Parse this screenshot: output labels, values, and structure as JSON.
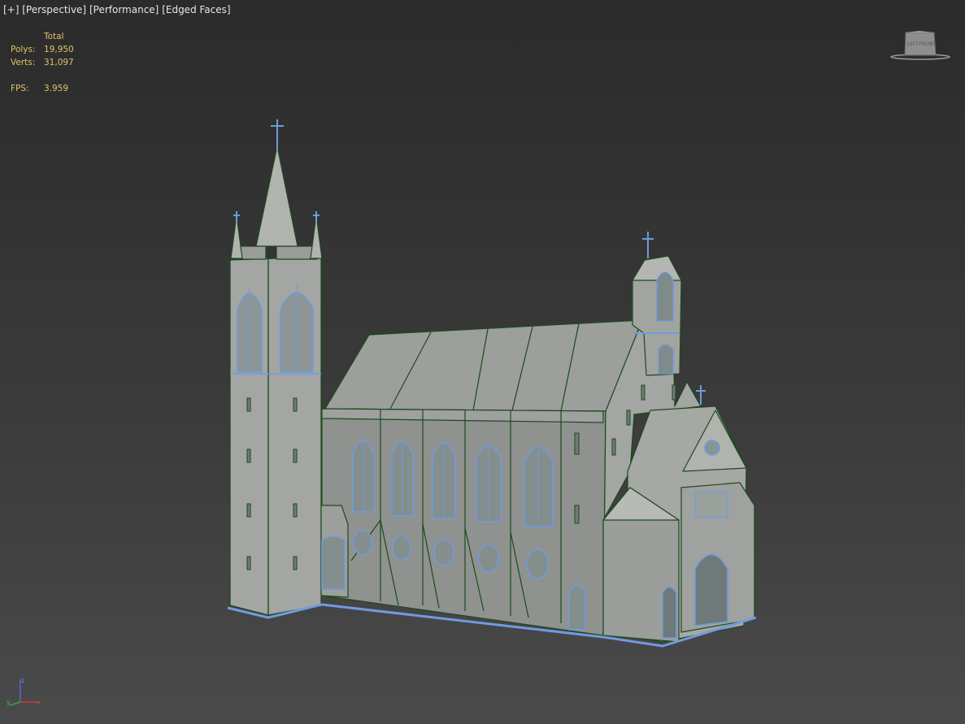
{
  "viewport": {
    "menu_plus": "[+]",
    "menu_view": "[Perspective]",
    "menu_shading": "[Performance]",
    "menu_faces": "[Edged Faces]"
  },
  "stats": {
    "header": "Total",
    "polys_label": "Polys:",
    "polys_value": "19,950",
    "verts_label": "Verts:",
    "verts_value": "31,097",
    "fps_label": "FPS:",
    "fps_value": "3.959"
  },
  "viewcube": {
    "left_face": "LEFT",
    "front_face": "FRONT"
  },
  "axis": {
    "z_label": "z",
    "x_label": "x",
    "y_label": "y"
  },
  "colors": {
    "model_fill": "#9a9d99",
    "model_edge": "#1d4a1d",
    "selection_edge": "#6f9be0",
    "stats_text": "#e0c36a"
  },
  "icons": {
    "viewcube": "viewcube-icon",
    "axis": "axis-tripod-icon"
  }
}
